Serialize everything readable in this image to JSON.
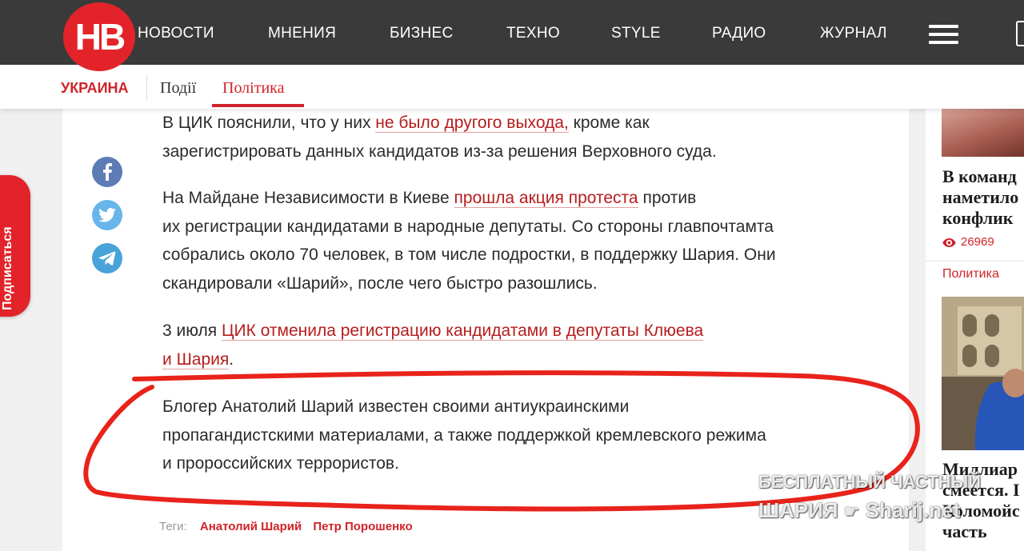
{
  "header": {
    "logo": "НВ",
    "nav": [
      "НОВОСТИ",
      "МНЕНИЯ",
      "БИЗНЕС",
      "ТЕХНО",
      "STYLE",
      "РАДИО",
      "ЖУРНАЛ"
    ]
  },
  "subnav": {
    "section": "УКРАИНА",
    "tabs": [
      "Події",
      "Політика"
    ],
    "active_tab": "Політика"
  },
  "subscribe_label": "Подписаться",
  "article": {
    "p1": {
      "pre": "В ЦИК пояснили, что у них ",
      "link": "не было другого выхода,",
      "post_line1": " кроме как",
      "line2": "зарегистрировать данных кандидатов из-за решения Верховного суда."
    },
    "p2": {
      "pre": "На Майдане Независимости в Киеве ",
      "link": "прошла акция протеста",
      "post_line1": " против",
      "line2": "их регистрации кандидатами в народные депутаты. Со стороны главпочтамта",
      "line3": "собрались около 70 человек, в том числе подростки, в поддержку Шария. Они",
      "line4": "скандировали «Шарий», после чего быстро разошлись."
    },
    "p3": {
      "pre": "3 июля ",
      "link_line1": "ЦИК отменила регистрацию кандидатами в депутаты Клюева",
      "link_line2": "и Шария",
      "post": "."
    },
    "p4": {
      "line1": "Блогер Анатолий Шарий известен своими антиукраинскими",
      "line2": "пропагандистскими материалами, а также поддержкой кремлевского режима",
      "line3": "и пророссийских террористов."
    },
    "tags_label": "Теги:",
    "tags": [
      "Анатолий Шарий",
      "Петр Порошенко"
    ]
  },
  "sidebar": {
    "item1": {
      "title_lines": [
        "В команд",
        "наметило",
        "конфлик"
      ],
      "views": "26969"
    },
    "item2": {
      "category": "Политика",
      "title_lines": [
        "Миллиар",
        "смеется. I",
        "Коломойс",
        "часть"
      ]
    }
  },
  "watermark": {
    "line1": "БЕСПЛАТНЫЙ ЧАСТНЫЙ",
    "line2_a": "ШАРИЯ",
    "line2_b": "Sharij.net"
  },
  "colors": {
    "brand_red": "#e3232a",
    "link_red": "#b71c1c",
    "annotation_red": "#e8231b",
    "facebook": "#5d7bb4",
    "twitter": "#67b5ea",
    "telegram": "#49a3d9"
  }
}
